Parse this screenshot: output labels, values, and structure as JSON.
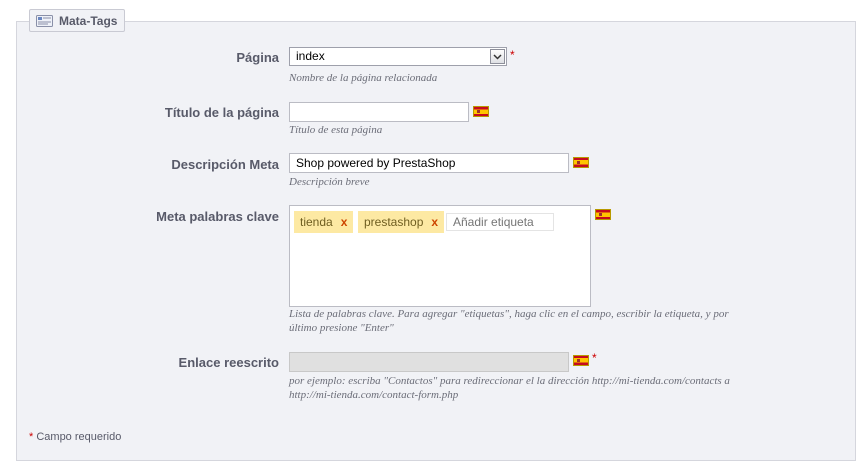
{
  "legend": {
    "title": "Mata-Tags",
    "icon": "meta-tags-icon"
  },
  "pagina": {
    "label": "Página",
    "selected": "index",
    "required": "*",
    "hint": "Nombre de la página relacionada"
  },
  "titulo": {
    "label": "Título de la página",
    "value": "",
    "hint": "Título de esta página",
    "flag": "spain-flag-icon"
  },
  "descripcion": {
    "label": "Descripción Meta",
    "value": "Shop powered by PrestaShop",
    "hint": "Descripción breve",
    "flag": "spain-flag-icon"
  },
  "keywords": {
    "label": "Meta palabras clave",
    "tags": [
      {
        "text": "tienda",
        "remove": "x"
      },
      {
        "text": "prestashop",
        "remove": "x"
      }
    ],
    "placeholder": "Añadir etiqueta",
    "hint_line1": "Lista de palabras clave. Para agregar \"etiquetas\", haga clic en el campo, escribir la etiqueta, y por",
    "hint_line2": "último presione \"Enter\"",
    "flag": "spain-flag-icon"
  },
  "enlace": {
    "label": "Enlace reescrito",
    "value": "",
    "required": "*",
    "hint_line1": "por ejemplo: escriba \"Contactos\" para redireccionar el la dirección http://mi-tienda.com/contacts a",
    "hint_line2": "http://mi-tienda.com/contact-form.php",
    "flag": "spain-flag-icon"
  },
  "footer": {
    "required_star": "*",
    "text": "Campo requerido"
  },
  "colors": {
    "panel_bg": "#f1f2f6",
    "label_color": "#585a69",
    "tag_bg": "#fde9a3",
    "required": "#cc0000"
  }
}
